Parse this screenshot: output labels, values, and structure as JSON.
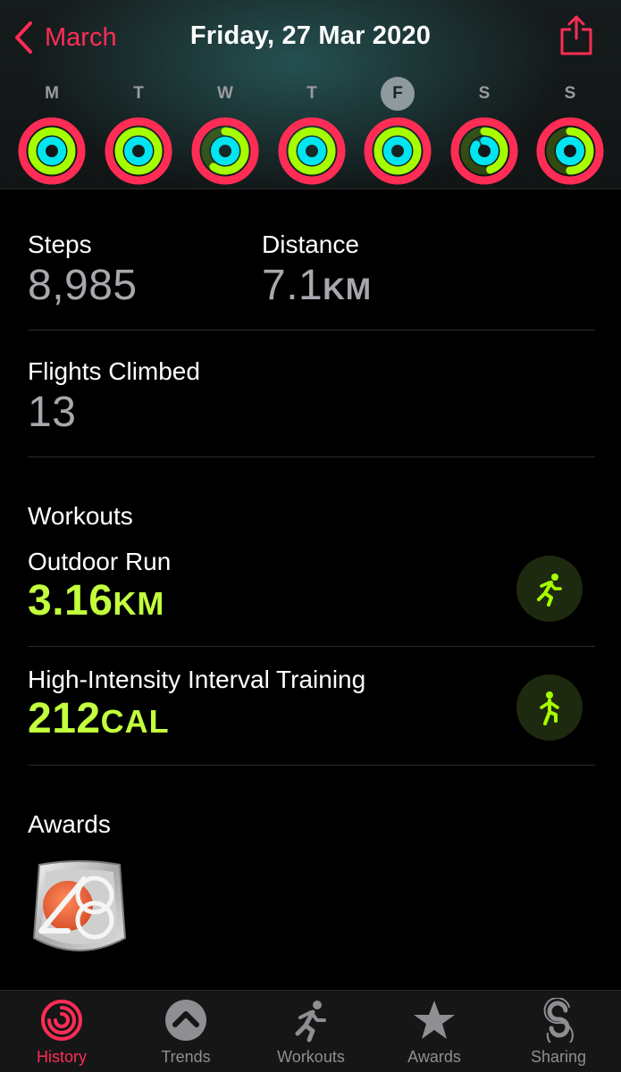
{
  "header": {
    "back_label": "March",
    "title": "Friday, 27 Mar 2020"
  },
  "week": [
    {
      "letter": "M",
      "move": 1.0,
      "exercise": 1.0,
      "stand": 1.0,
      "selected": false
    },
    {
      "letter": "T",
      "move": 1.0,
      "exercise": 1.0,
      "stand": 1.0,
      "selected": false
    },
    {
      "letter": "W",
      "move": 1.0,
      "exercise": 0.6,
      "stand": 1.0,
      "selected": false
    },
    {
      "letter": "T",
      "move": 1.0,
      "exercise": 1.0,
      "stand": 1.0,
      "selected": false
    },
    {
      "letter": "F",
      "move": 1.0,
      "exercise": 1.0,
      "stand": 1.0,
      "selected": true
    },
    {
      "letter": "S",
      "move": 1.0,
      "exercise": 0.45,
      "stand": 0.85,
      "selected": false
    },
    {
      "letter": "S",
      "move": 1.0,
      "exercise": 0.5,
      "stand": 1.0,
      "selected": false
    }
  ],
  "ring_colors": {
    "move": "#ff2d55",
    "exercise": "#a6ff00",
    "stand": "#00e5f0"
  },
  "stats": {
    "steps_label": "Steps",
    "steps_value": "8,985",
    "distance_label": "Distance",
    "distance_value": "7.1",
    "distance_unit": "KM",
    "flights_label": "Flights Climbed",
    "flights_value": "13"
  },
  "workouts": {
    "heading": "Workouts",
    "items": [
      {
        "name": "Outdoor Run",
        "value": "3.16",
        "unit": "KM",
        "icon": "running-icon"
      },
      {
        "name": "High-Intensity Interval Training",
        "value": "212",
        "unit": "CAL",
        "icon": "hiit-icon"
      }
    ]
  },
  "awards": {
    "heading": "Awards",
    "badge_icon": "anniversary-badge-icon"
  },
  "tabbar": {
    "tabs": [
      {
        "label": "History",
        "icon": "history-icon",
        "active": true
      },
      {
        "label": "Trends",
        "icon": "trends-icon",
        "active": false
      },
      {
        "label": "Workouts",
        "icon": "workouts-icon",
        "active": false
      },
      {
        "label": "Awards",
        "icon": "awards-icon",
        "active": false
      },
      {
        "label": "Sharing",
        "icon": "sharing-icon",
        "active": false
      }
    ]
  }
}
